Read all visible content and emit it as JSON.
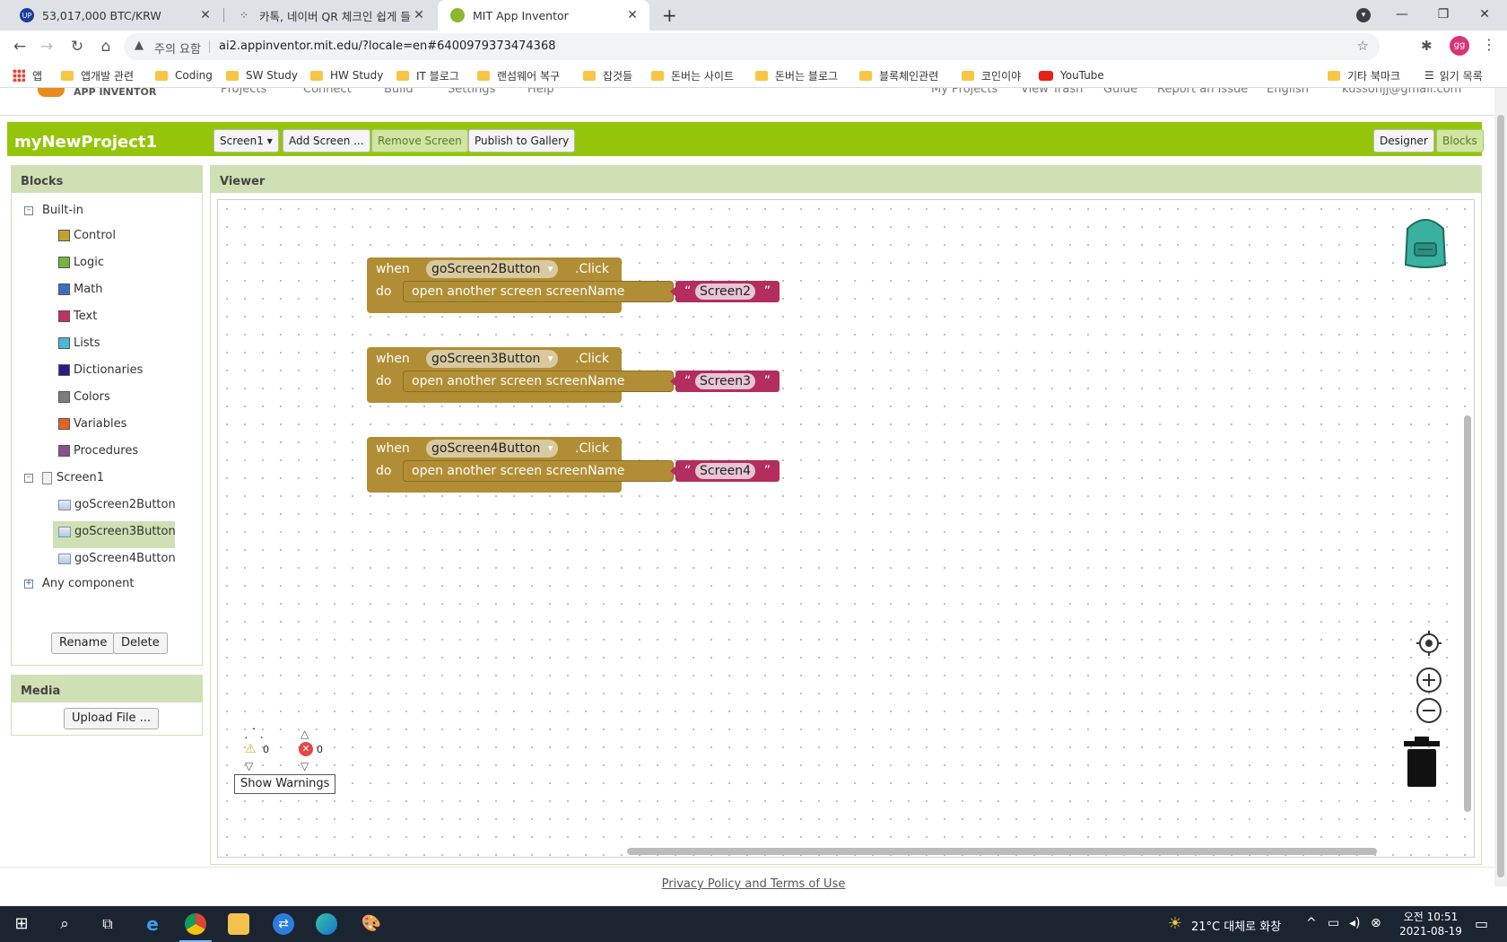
{
  "browser": {
    "tabs": [
      {
        "title": "53,017,000 BTC/KRW",
        "favicon": "upbit-icon"
      },
      {
        "title": "카톡, 네이버 QR 체크인 쉽게 들",
        "favicon": "kakao-icon"
      },
      {
        "title": "MIT App Inventor",
        "favicon": "appinventor-icon"
      }
    ],
    "new_tab": "+",
    "security_label": "주의 요함",
    "url": "ai2.appinventor.mit.edu/?locale=en#6400979373474368",
    "profile_initials": "gg",
    "bookmarks": [
      "앱",
      "앱개발 관련",
      "Coding",
      "SW Study",
      "HW Study",
      "IT 블로그",
      "랜섬웨어 복구",
      "잡것들",
      "돈버는 사이트",
      "돈버는 블로그",
      "블록체인관련",
      "코인이야",
      "YouTube"
    ],
    "other_bookmarks": "기타 북마크",
    "reading_list": "읽기 목록"
  },
  "app": {
    "logo_text": "APP INVENTOR",
    "top_menu_left": [
      "Projects",
      "Connect",
      "Build",
      "Settings",
      "Help"
    ],
    "top_menu_right": [
      "My Projects",
      "View Trash",
      "Guide",
      "Report an Issue",
      "English",
      "kussonjj@gmail.com"
    ],
    "project_title": "myNewProject1",
    "screen_select": "Screen1 ▾",
    "add_screen": "Add Screen ...",
    "remove_screen": "Remove Screen",
    "publish": "Publish to Gallery",
    "designer": "Designer",
    "blocks_btn": "Blocks",
    "blocks_panel": {
      "title": "Blocks",
      "builtin": "Built-in",
      "categories": [
        {
          "label": "Control",
          "color": "#c8a12d"
        },
        {
          "label": "Logic",
          "color": "#78b43c"
        },
        {
          "label": "Math",
          "color": "#3b6fc2"
        },
        {
          "label": "Text",
          "color": "#c2306a"
        },
        {
          "label": "Lists",
          "color": "#46b8d8"
        },
        {
          "label": "Dictionaries",
          "color": "#2c1a8c"
        },
        {
          "label": "Colors",
          "color": "#7c7c7c"
        },
        {
          "label": "Variables",
          "color": "#e5651e"
        },
        {
          "label": "Procedures",
          "color": "#8a4f8f"
        }
      ],
      "screen": "Screen1",
      "components": [
        "goScreen2Button",
        "goScreen3Button",
        "goScreen4Button"
      ],
      "any_component": "Any component",
      "rename": "Rename",
      "delete": "Delete"
    },
    "media_panel": {
      "title": "Media",
      "upload": "Upload File ..."
    },
    "viewer": {
      "title": "Viewer",
      "blocks": [
        {
          "when": "when",
          "component": "goScreen2Button",
          "event": ".Click",
          "do": "do",
          "action": "open   another   screen   screenName",
          "value": "Screen2",
          "open_quote": "“",
          "close_quote": "”"
        },
        {
          "when": "when",
          "component": "goScreen3Button",
          "event": ".Click",
          "do": "do",
          "action": "open   another   screen   screenName",
          "value": "Screen3",
          "open_quote": "“",
          "close_quote": "”"
        },
        {
          "when": "when",
          "component": "goScreen4Button",
          "event": ".Click",
          "do": "do",
          "action": "open   another   screen   screenName",
          "value": "Screen4",
          "open_quote": "“",
          "close_quote": "”"
        }
      ],
      "warnings_count": "0",
      "errors_count": "0",
      "show_warnings": "Show Warnings"
    },
    "footer": "Privacy Policy and Terms of Use"
  },
  "taskbar": {
    "weather": "21°C  대체로 화창",
    "time": "오전 10:51",
    "date": "2021-08-19"
  }
}
